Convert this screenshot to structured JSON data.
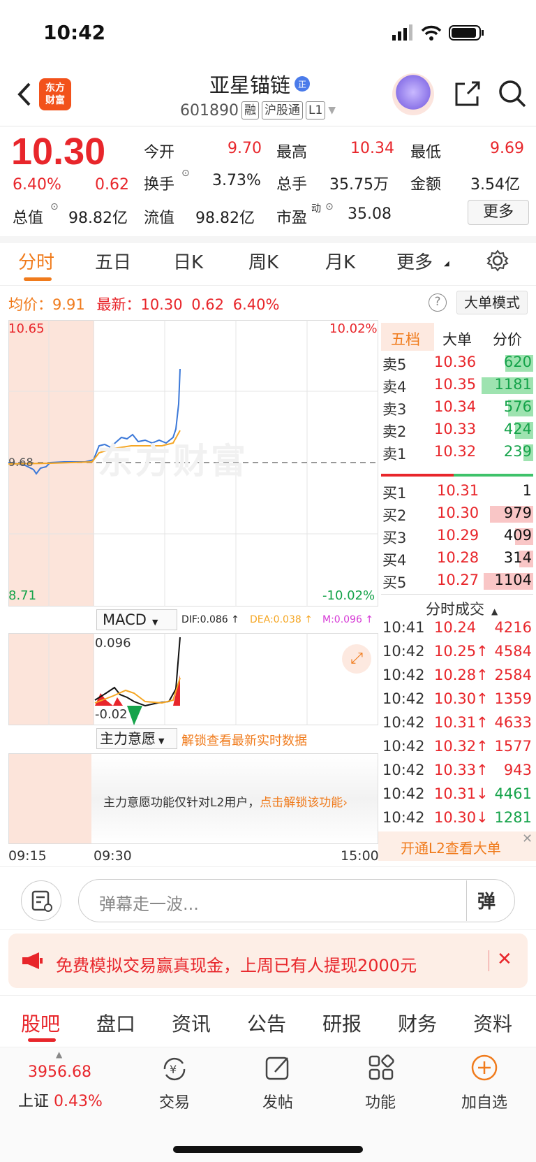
{
  "status": {
    "time": "10:42"
  },
  "header": {
    "logo_text": "东方\n财富",
    "name": "亚星锚链",
    "name_badge": "正",
    "code": "601890",
    "tags": [
      "融",
      "沪股通",
      "L1"
    ]
  },
  "quote": {
    "price": "10.30",
    "pct": "6.40%",
    "change": "0.62",
    "open_label": "今开",
    "open": "9.70",
    "high_label": "最高",
    "high": "10.34",
    "low_label": "最低",
    "low": "9.69",
    "turnover_label": "换手",
    "turnover": "3.73%",
    "volume_label": "总手",
    "volume": "35.75万",
    "amount_label": "金额",
    "amount": "3.54亿",
    "mcap_label": "总值",
    "mcap": "98.82亿",
    "float_label": "流值",
    "float": "98.82亿",
    "pe_label": "市盈",
    "pe_sup": "动",
    "pe": "35.08",
    "more": "更多"
  },
  "tabs": [
    "分时",
    "五日",
    "日K",
    "周K",
    "月K",
    "更多"
  ],
  "info": {
    "avg_label": "均价：",
    "avg": "9.91",
    "last_label": "最新：",
    "last": "10.30",
    "chg": "0.62",
    "pct": "6.40%",
    "mode": "大单模式",
    "help": "?"
  },
  "chart": {
    "ymax": "10.65",
    "ymin": "8.71",
    "pmax": "10.02%",
    "pmin": "-10.02%",
    "mid": "9.68",
    "watermark": "东方财富",
    "t1": "09:15",
    "t2": "09:30",
    "t3": "15:00",
    "macd_label": "MACD",
    "dif": "DIF:0.086 ↑",
    "dea": "DEA:0.038 ↑",
    "m": "M:0.096 ↑",
    "macd_max": "0.096",
    "macd_min": "-0.02",
    "zl_label": "主力意愿",
    "zl_unlock": "解锁查看最新实时数据",
    "zl_msg": "主力意愿功能仅针对L2用户，",
    "zl_link": "点击解锁该功能"
  },
  "colors": {
    "red": "#e8262b",
    "green": "#15a34a",
    "orange": "#f07b1c",
    "blue": "#3b78d8",
    "yellow": "#f5a623"
  },
  "orderbook": {
    "tabs": [
      "五档",
      "大单",
      "分价"
    ],
    "asks": [
      {
        "label": "卖5",
        "price": "10.36",
        "vol": "620",
        "frac": 0.33
      },
      {
        "label": "卖4",
        "price": "10.35",
        "vol": "1181",
        "frac": 0.62
      },
      {
        "label": "卖3",
        "price": "10.34",
        "vol": "576",
        "frac": 0.3
      },
      {
        "label": "卖2",
        "price": "10.33",
        "vol": "424",
        "frac": 0.22
      },
      {
        "label": "卖1",
        "price": "10.32",
        "vol": "239",
        "frac": 0.12
      }
    ],
    "bids": [
      {
        "label": "买1",
        "price": "10.31",
        "vol": "1",
        "frac": 0.0
      },
      {
        "label": "买2",
        "price": "10.30",
        "vol": "979",
        "frac": 0.52
      },
      {
        "label": "买3",
        "price": "10.29",
        "vol": "409",
        "frac": 0.22
      },
      {
        "label": "买4",
        "price": "10.28",
        "vol": "314",
        "frac": 0.17
      },
      {
        "label": "买5",
        "price": "10.27",
        "vol": "1104",
        "frac": 0.59
      }
    ],
    "ticks_title": "分时成交",
    "ticks": [
      {
        "t": "10:41",
        "p": "10.24",
        "v": "4216",
        "dir": ""
      },
      {
        "t": "10:42",
        "p": "10.25↑",
        "v": "4584",
        "dir": "up"
      },
      {
        "t": "10:42",
        "p": "10.28↑",
        "v": "2584",
        "dir": "up"
      },
      {
        "t": "10:42",
        "p": "10.30↑",
        "v": "1359",
        "dir": "up"
      },
      {
        "t": "10:42",
        "p": "10.31↑",
        "v": "4633",
        "dir": "up"
      },
      {
        "t": "10:42",
        "p": "10.32↑",
        "v": "1577",
        "dir": "up"
      },
      {
        "t": "10:42",
        "p": "10.33↑",
        "v": "943",
        "dir": "up"
      },
      {
        "t": "10:42",
        "p": "10.31↓",
        "v": "4461",
        "dir": "down"
      },
      {
        "t": "10:42",
        "p": "10.30↓",
        "v": "1281",
        "dir": "down"
      }
    ],
    "l2_text": "开通L2查看大单"
  },
  "comment": {
    "placeholder": "弹幕走一波...",
    "btn": "弹"
  },
  "banner": {
    "text": "免费模拟交易赢真现金，上周已有人提现2000元"
  },
  "bottom_tabs": [
    "股吧",
    "盘口",
    "资讯",
    "公告",
    "研报",
    "财务",
    "资料"
  ],
  "bottom_nav": {
    "index_value": "3956.68",
    "index_name": "上证",
    "index_pct": "0.43%",
    "trade": "交易",
    "post": "发帖",
    "func": "功能",
    "add": "加自选"
  }
}
